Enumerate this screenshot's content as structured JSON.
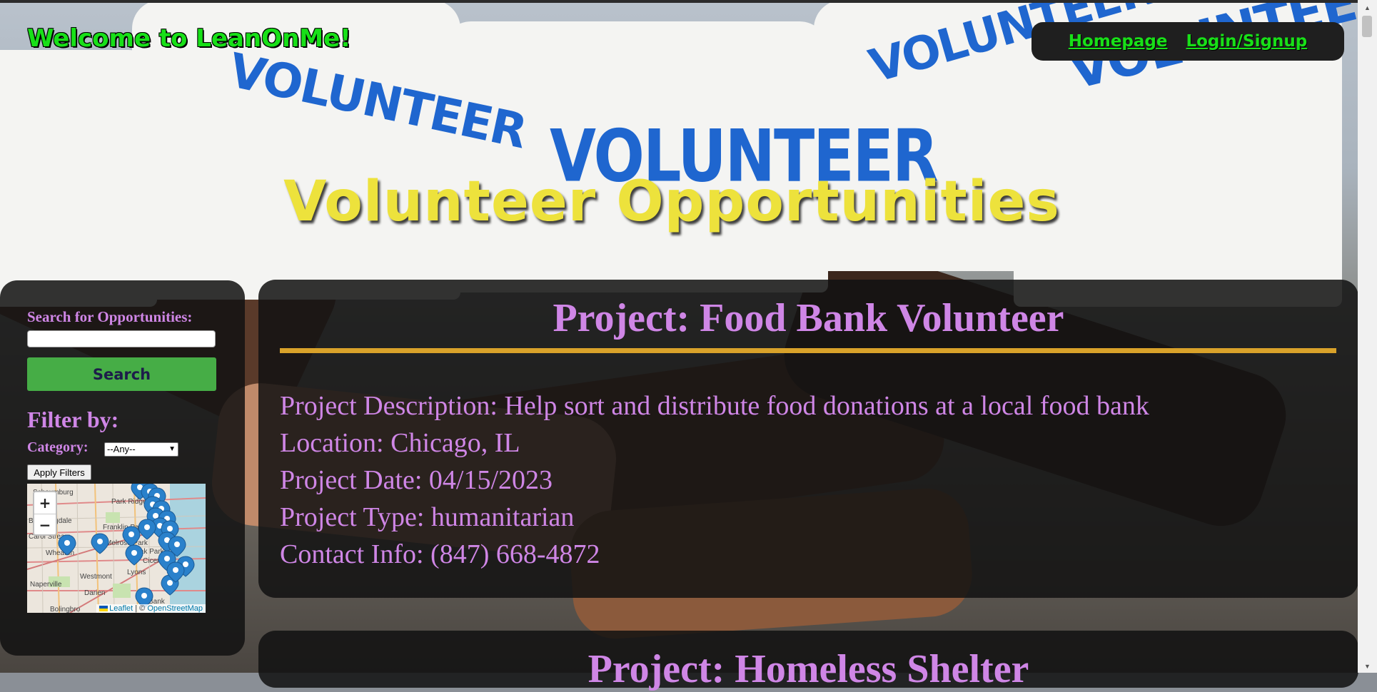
{
  "header": {
    "welcome": "Welcome to LeanOnMe!",
    "nav": {
      "homepage": "Homepage",
      "login": "Login/Signup"
    },
    "page_title": "Volunteer Opportunities",
    "photo_text": "VOLUNTEER"
  },
  "sidebar": {
    "search_label": "Search for Opportunities:",
    "search_value": "",
    "search_button": "Search",
    "filter_title": "Filter by:",
    "category_label": "Category:",
    "category_selected": "--Any--",
    "apply_button": "Apply Filters",
    "map": {
      "zoom_in": "+",
      "zoom_out": "−",
      "attrib_leaflet": "Leaflet",
      "attrib_sep": " | © ",
      "attrib_osm": "OpenStreetMap",
      "place_labels": [
        "Schaumburg",
        "Park Ridge",
        "Bloomingdale",
        "Franklin Park",
        "Carol Stream",
        "Melrose Park",
        "Wheaton",
        "Cicero",
        "Westmont",
        "Lyons",
        "Naperville",
        "Darien",
        "Bolingbro",
        "Oak Park",
        "Bank"
      ]
    }
  },
  "projects": [
    {
      "title": "Project: Food Bank Volunteer",
      "description": "Project Description: Help sort and distribute food donations at a local food bank",
      "location": "Location: Chicago, IL",
      "date": "Project Date: 04/15/2023",
      "type": "Project Type: humanitarian",
      "contact": "Contact Info: (847) 668-4872"
    },
    {
      "title": "Project: Homeless Shelter"
    }
  ],
  "colors": {
    "accent_green": "#18e018",
    "title_yellow": "#ede23c",
    "text_purple": "#cf86e6",
    "rule_gold": "#d9a22a",
    "button_green": "#46ad46"
  }
}
